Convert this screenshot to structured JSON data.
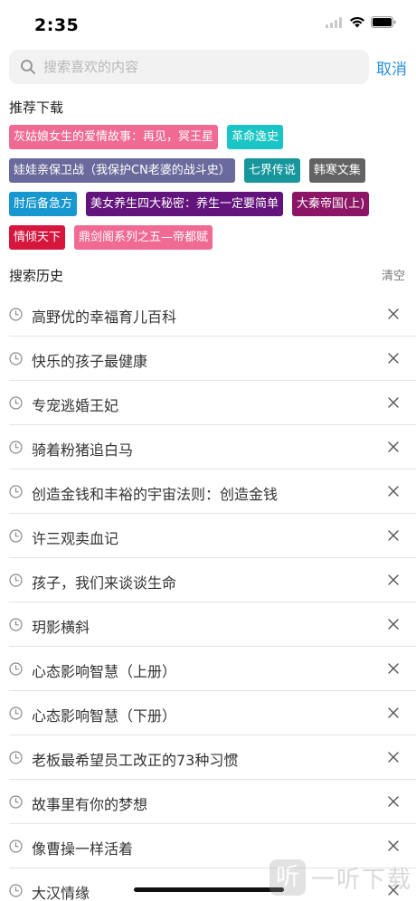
{
  "status": {
    "time": "2:35"
  },
  "search": {
    "placeholder": "搜索喜欢的内容",
    "value": "",
    "cancel_label": "取消"
  },
  "recommended": {
    "title": "推荐下载",
    "rows": [
      [
        {
          "label": "灰姑娘女生的爱情故事：再见，冥王星",
          "color": "#f06a94"
        },
        {
          "label": "革命逸史",
          "color": "#1ac5c5"
        }
      ],
      [
        {
          "label": "娃娃亲保卫战（我保护CN老婆的战斗史）",
          "color": "#6a6a9c"
        },
        {
          "label": "七界传说",
          "color": "#17979c"
        },
        {
          "label": "韩寒文集",
          "color": "#636363"
        }
      ],
      [
        {
          "label": "肘后备急方",
          "color": "#1797cf"
        },
        {
          "label": "美女养生四大秘密：养生一定要简单",
          "color": "#62137c"
        },
        {
          "label": "大秦帝国(上)",
          "color": "#8c1566"
        }
      ],
      [
        {
          "label": "情倾天下",
          "color": "#d6163d"
        },
        {
          "label": "鼎剑阁系列之五—帝都赋",
          "color": "#f06a94"
        }
      ]
    ]
  },
  "history": {
    "title": "搜索历史",
    "clear_label": "清空",
    "items": [
      "高野优的幸福育儿百科",
      "快乐的孩子最健康",
      "专宠逃婚王妃",
      "骑着粉猪追白马",
      "创造金钱和丰裕的宇宙法则：创造金钱",
      "许三观卖血记",
      "孩子，我们来谈谈生命",
      "玥影横斜",
      "心态影响智慧（上册）",
      "心态影响智慧（下册）",
      "老板最希望员工改正的73种习惯",
      "故事里有你的梦想",
      "像曹操一样活着",
      "大汉情缘"
    ]
  },
  "watermark": {
    "logo": "听",
    "text": "一听下载"
  }
}
